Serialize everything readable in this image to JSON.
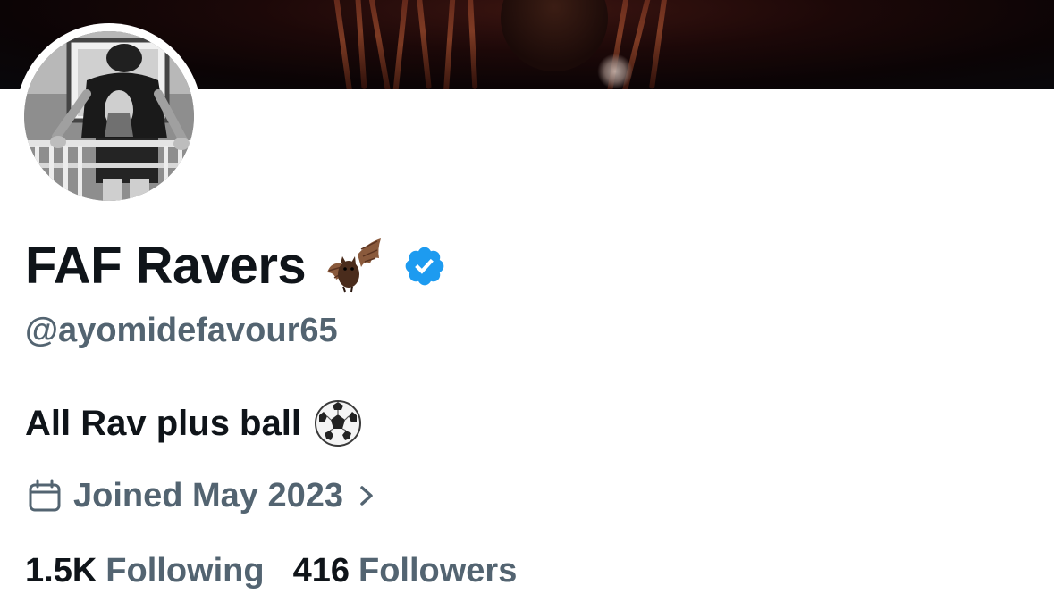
{
  "profile": {
    "display_name": "FAF Ravers",
    "name_emoji": "bat-emoji",
    "verified": "verified-badge",
    "handle": "@ayomidefavour65",
    "bio_text": "All Rav plus ball",
    "bio_emoji": "soccer-ball-emoji",
    "joined": "Joined May 2023"
  },
  "stats": {
    "following_count": "1.5K",
    "following_label": "Following",
    "followers_count": "416",
    "followers_label": "Followers"
  },
  "colors": {
    "primary_text": "#0f1419",
    "secondary_text": "#536471",
    "verified_blue": "#1d9bf0",
    "background": "#ffffff"
  }
}
